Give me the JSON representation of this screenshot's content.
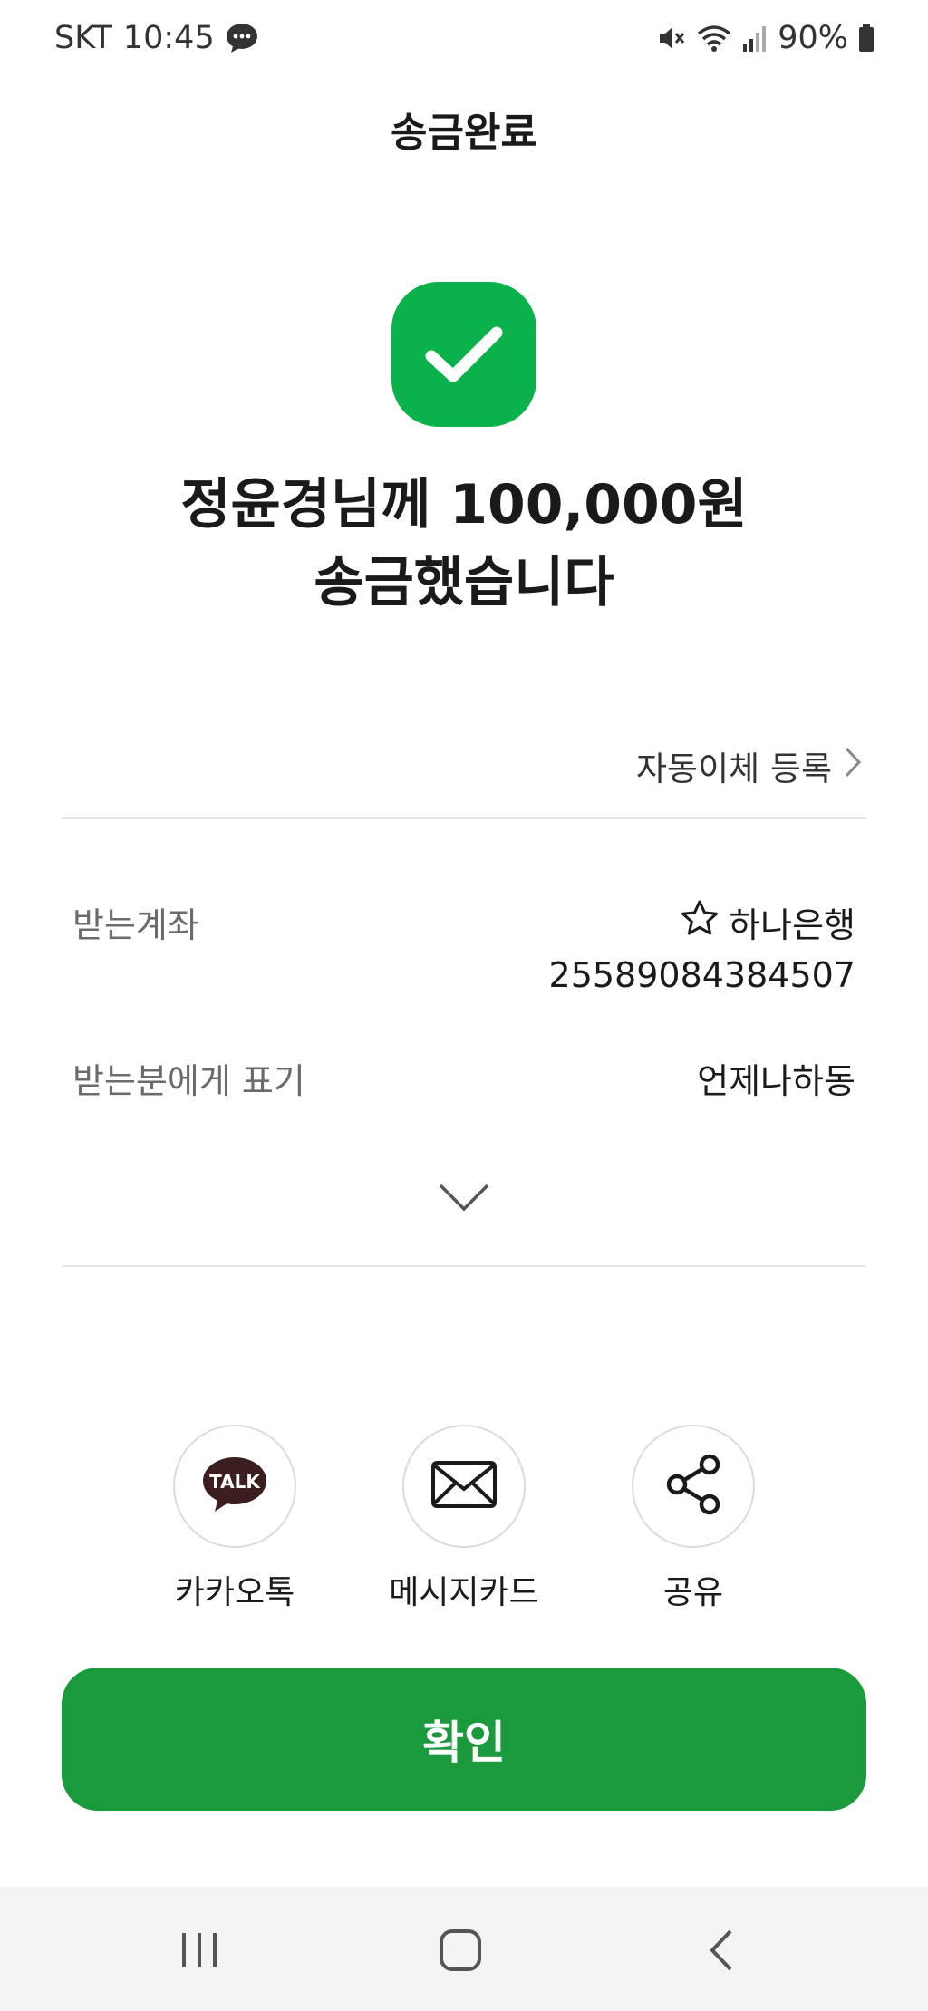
{
  "status_bar": {
    "carrier": "SKT",
    "time": "10:45",
    "battery": "90%",
    "icons": [
      "chat-bubble-icon",
      "mute-icon",
      "wifi-icon",
      "signal-icon",
      "battery-icon"
    ]
  },
  "header": {
    "title": "송금완료"
  },
  "result": {
    "icon": "check-icon",
    "line1": "정윤경님께 100,000원",
    "line2": "송금했습니다"
  },
  "auto_transfer": {
    "label": "자동이체 등록"
  },
  "details": {
    "account_label": "받는계좌",
    "bank_name": "하나은행",
    "account_number": "25589084384507",
    "memo_label": "받는분에게 표기",
    "memo_value": "언제나하동"
  },
  "share": {
    "items": [
      {
        "label": "카카오톡",
        "icon": "kakaotalk-icon",
        "badge": "TALK"
      },
      {
        "label": "메시지카드",
        "icon": "envelope-icon"
      },
      {
        "label": "공유",
        "icon": "share-icon"
      }
    ]
  },
  "confirm_button": {
    "label": "확인"
  },
  "colors": {
    "success_green": "#0bb14a",
    "button_green": "#1a9a3c",
    "kakao_brown": "#3c1e1e"
  },
  "nav_bar": {
    "buttons": [
      "recent-apps-icon",
      "home-icon",
      "back-icon"
    ]
  }
}
